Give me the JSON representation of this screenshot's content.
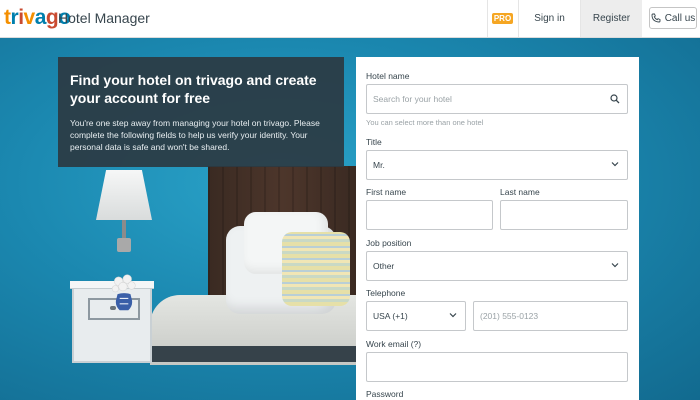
{
  "header": {
    "logo_text": "trivago",
    "app_title": "Hotel Manager",
    "pro_badge": "PRO",
    "signin_label": "Sign in",
    "register_label": "Register",
    "call_label": "Call us"
  },
  "intro": {
    "heading": "Find your hotel on trivago and create your account for free",
    "body": "You're one step away from managing your hotel on trivago. Please complete the following fields to help us verify your identity. Your personal data is safe and won't be shared."
  },
  "form": {
    "hotel_name_label": "Hotel name",
    "hotel_search_placeholder": "Search for your hotel",
    "hotel_hint": "You can select more than one hotel",
    "title_label": "Title",
    "title_value": "Mr.",
    "first_name_label": "First name",
    "last_name_label": "Last name",
    "job_position_label": "Job position",
    "job_position_value": "Other",
    "telephone_label": "Telephone",
    "country_code_value": "USA (+1)",
    "phone_placeholder": "(201) 555-0123",
    "work_email_label": "Work email (?)",
    "password_label": "Password"
  },
  "colors": {
    "brand_orange": "#f48f00",
    "brand_blue": "#007fad",
    "brand_red": "#c94a30",
    "intro_bg": "#2b3a42"
  }
}
